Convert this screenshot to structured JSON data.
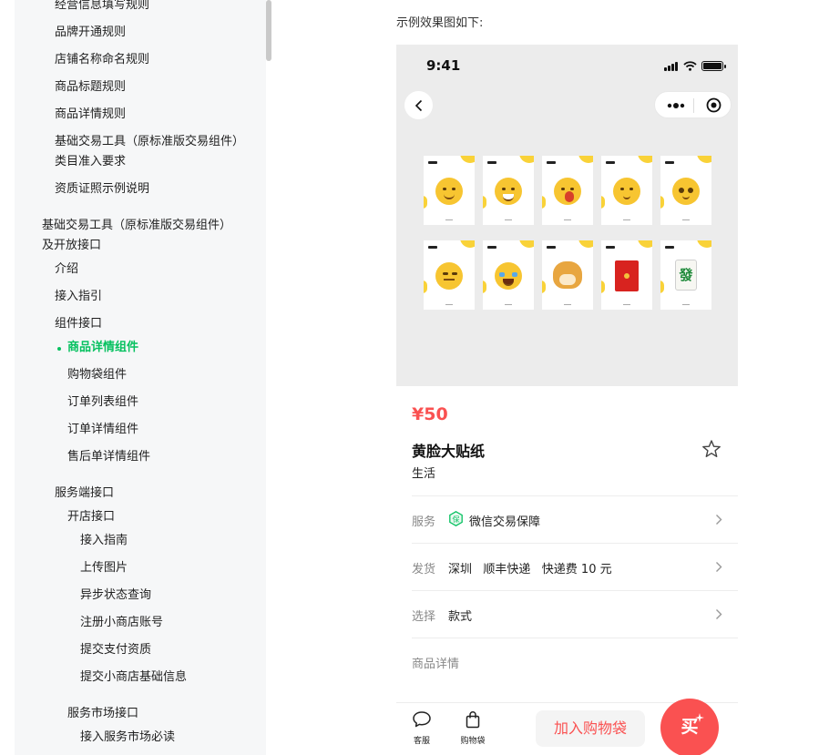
{
  "sidebar": {
    "items": [
      {
        "label": "经营信息填写规则"
      },
      {
        "label": "品牌开通规则"
      },
      {
        "label": "店铺名称命名规则"
      },
      {
        "label": "商品标题规则"
      },
      {
        "label": "商品详情规则"
      },
      {
        "label": "基础交易工具（原标准版交易组件）类目准入要求"
      },
      {
        "label": "资质证照示例说明"
      },
      {
        "label": "基础交易工具（原标准版交易组件）及开放接口"
      },
      {
        "label": "介绍"
      },
      {
        "label": "接入指引"
      },
      {
        "label": "组件接口"
      },
      {
        "label": "商品详情组件"
      },
      {
        "label": "购物袋组件"
      },
      {
        "label": "订单列表组件"
      },
      {
        "label": "订单详情组件"
      },
      {
        "label": "售后单详情组件"
      },
      {
        "label": "服务端接口"
      },
      {
        "label": "开店接口"
      },
      {
        "label": "接入指南"
      },
      {
        "label": "上传图片"
      },
      {
        "label": "异步状态查询"
      },
      {
        "label": "注册小商店账号"
      },
      {
        "label": "提交支付资质"
      },
      {
        "label": "提交小商店基础信息"
      },
      {
        "label": "服务市场接口"
      },
      {
        "label": "接入服务市场必读"
      }
    ],
    "active_index": 11
  },
  "content": {
    "caption": "示例效果图如下:"
  },
  "phone": {
    "status_time": "9:41",
    "stickers": [
      {
        "kind": "smile-face"
      },
      {
        "kind": "grin-face"
      },
      {
        "kind": "shy-face"
      },
      {
        "kind": "smirk-face"
      },
      {
        "kind": "wave-face"
      },
      {
        "kind": "side-eye-face"
      },
      {
        "kind": "laugh-cry-face"
      },
      {
        "kind": "doge"
      },
      {
        "kind": "red-packet"
      },
      {
        "kind": "mahjong-fa",
        "text": "發"
      }
    ],
    "price": "¥50",
    "product_name": "黄脸大贴纸",
    "product_category": "生活",
    "rows": {
      "service": {
        "label": "服务",
        "icon_text": "保",
        "value": "微信交易保障"
      },
      "shipping": {
        "label": "发货",
        "value": "深圳   顺丰快递   快递费 10 元"
      },
      "select": {
        "label": "选择",
        "value": "款式"
      }
    },
    "detail_label": "商品详情",
    "bottom": {
      "service_label": "客服",
      "cart_label": "购物袋",
      "add_to_cart": "加入购物袋",
      "buy": "买"
    },
    "colors": {
      "accent_green": "#07c160",
      "price_red": "#fa5151",
      "sticker_yellow": "#f9d238"
    }
  }
}
